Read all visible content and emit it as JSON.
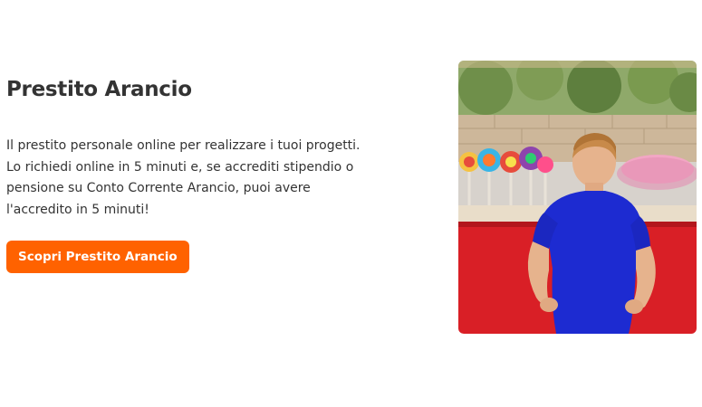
{
  "promo": {
    "title": "Prestito Arancio",
    "description": "Il prestito personale online per realizzare i tuoi progetti. Lo richiedi online in 5 minuti e, se accrediti stipendio o pensione su Conto Corrente Arancio, puoi avere l'accredito in 5 minuti!",
    "cta_label": "Scopri Prestito Arancio"
  },
  "colors": {
    "accent": "#ff6200",
    "text": "#333333",
    "background": "#ffffff"
  },
  "image": {
    "subject": "child-looking-at-lollipop-stall"
  }
}
